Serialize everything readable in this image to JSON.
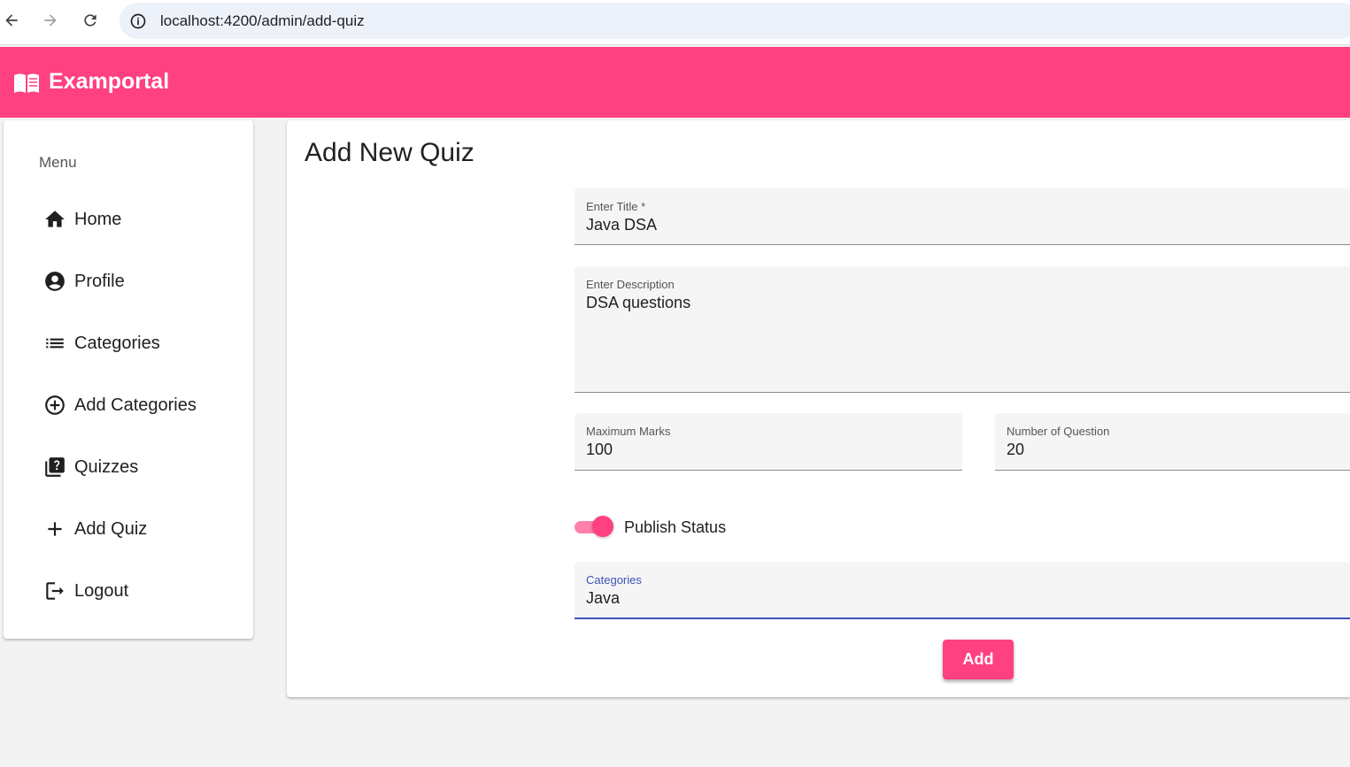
{
  "browser": {
    "url": "localhost:4200/admin/add-quiz",
    "icons": [
      "back-arrow-icon",
      "forward-arrow-icon",
      "reload-icon",
      "info-icon"
    ]
  },
  "toolbar": {
    "brand": "Examportal",
    "color": "#ff4081",
    "icon": "menu-book-icon"
  },
  "sidebar": {
    "header": "Menu",
    "items": [
      {
        "label": "Home",
        "icon": "home-icon"
      },
      {
        "label": "Profile",
        "icon": "account-circle-icon"
      },
      {
        "label": "Categories",
        "icon": "list-icon"
      },
      {
        "label": "Add Categories",
        "icon": "add-circle-outline-icon"
      },
      {
        "label": "Quizzes",
        "icon": "quiz-icon"
      },
      {
        "label": "Add Quiz",
        "icon": "add-icon"
      },
      {
        "label": "Logout",
        "icon": "logout-icon"
      }
    ]
  },
  "form": {
    "title": "Add New Quiz",
    "title_field": {
      "label": "Enter Title *",
      "value": "Java DSA"
    },
    "description_field": {
      "label": "Enter Description",
      "value": "DSA questions"
    },
    "max_marks_field": {
      "label": "Maximum Marks",
      "value": "100"
    },
    "num_questions_field": {
      "label": "Number of Question",
      "value": "20"
    },
    "publish": {
      "label": "Publish Status",
      "checked": true
    },
    "category_field": {
      "label": "Categories",
      "value": "Java"
    },
    "submit_label": "Add"
  }
}
